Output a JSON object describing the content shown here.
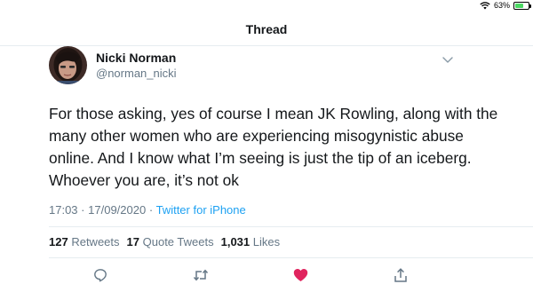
{
  "status_bar": {
    "battery_text": "63%",
    "battery_level": 0.63,
    "wifi_icon": "wifi-icon"
  },
  "header": {
    "title": "Thread"
  },
  "tweet": {
    "author_name": "Nicki Norman",
    "author_handle": "@norman_nicki",
    "text": "For those asking, yes of course I mean JK Rowling, along with the many other women who are experiencing misogynistic abuse online. And I know what I’m seeing is just the tip of an iceberg. Whoever you are, it’s not ok",
    "time": "17:03",
    "separator": "·",
    "date": "17/09/2020",
    "source": "Twitter for iPhone"
  },
  "stats": {
    "retweets_count": "127",
    "retweets_label": "Retweets",
    "quote_count": "17",
    "quote_label": "Quote Tweets",
    "likes_count": "1,031",
    "likes_label": "Likes"
  },
  "actions": {
    "reply_icon": "reply-icon",
    "retweet_icon": "retweet-icon",
    "like_icon": "heart-icon",
    "share_icon": "share-icon",
    "liked": true,
    "like_color": "#e0245e",
    "icon_color": "#657786"
  },
  "colors": {
    "link": "#1da1f2",
    "muted": "#657786",
    "text": "#14171a",
    "divider": "#e6ecf0"
  }
}
